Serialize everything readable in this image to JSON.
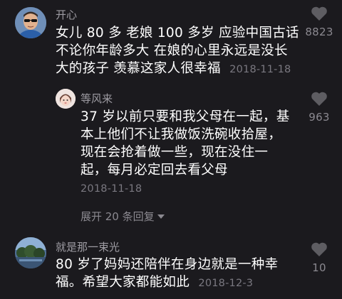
{
  "comments": [
    {
      "name": "开心",
      "lines": [
        "女儿 80 多 老娘 100 多岁 应验中国古话",
        "不论你年龄多大 在娘的心里永远是没长",
        "大的孩子 羡慕这家人很幸福"
      ],
      "timestamp": "2018-11-18",
      "likes": "8823",
      "avatar_icon": "man-with-sunglasses-avatar"
    },
    {
      "name": "等风来",
      "lines": [
        "37 岁以前只要和我父母在一起，基",
        "本上他们不让我做饭洗碗收拾屋，",
        "现在会抢着做一些，现在没住一",
        "起，每月必定回去看父母"
      ],
      "timestamp": "2018-11-18",
      "likes": "963",
      "avatar_icon": "girl-avatar"
    },
    {
      "name": "就是那一束光",
      "lines": [
        "80 岁了妈妈还陪伴在身边就是一种幸",
        "福。希望大家都能如此"
      ],
      "timestamp": "2018-12-3",
      "likes": "10",
      "avatar_icon": "landscape-avatar"
    }
  ],
  "expand_replies": "展开 20 条回复",
  "like_icon": "heart-icon",
  "colors": {
    "background": "#1b1a1e",
    "text": "#ffffff",
    "muted": "#8b8990",
    "heart": "#5e5d62"
  }
}
